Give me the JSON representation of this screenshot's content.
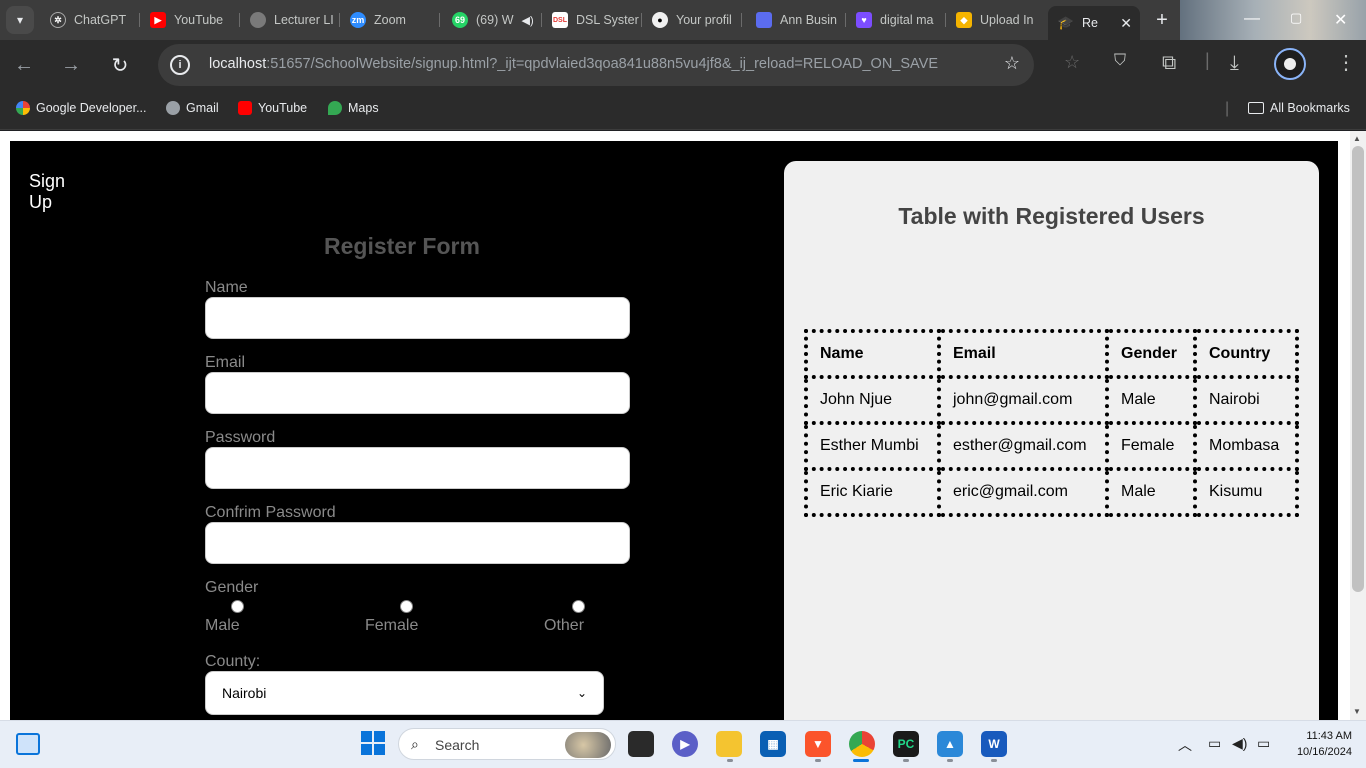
{
  "browser": {
    "tabs": [
      {
        "label": "ChatGPT",
        "icon": "chatgpt-icon",
        "color": "#ffffff"
      },
      {
        "label": "YouTube",
        "icon": "youtube-icon",
        "color": "#ff0000"
      },
      {
        "label": "Lecturer LI",
        "icon": "globe-icon",
        "color": "#7a7a7a"
      },
      {
        "label": "Zoom",
        "icon": "zoom-icon",
        "color": "#2d8cff"
      },
      {
        "label": "(69) W",
        "icon": "whatsapp-icon",
        "color": "#25d366"
      },
      {
        "label": "DSL Syster",
        "icon": "dsl-icon",
        "color": "#e53935"
      },
      {
        "label": "Your profil",
        "icon": "github-icon",
        "color": "#f0f0f0"
      },
      {
        "label": "Ann Busin",
        "icon": "app-icon",
        "color": "#5b6cf0"
      },
      {
        "label": "digital ma",
        "icon": "heart-icon",
        "color": "#7c4dff"
      },
      {
        "label": "Upload In",
        "icon": "upload-icon",
        "color": "#f5b400"
      },
      {
        "label": "Re",
        "icon": "graduation-cap-icon",
        "color": "#e8eaed"
      }
    ],
    "new_tab": "+",
    "url_host": "localhost",
    "url_rest": ":51657/SchoolWebsite/signup.html?_ijt=qpdvlaied3qoa841u88n5vu4jf8&_ij_reload=RELOAD_ON_SAVE",
    "bookmarks": [
      {
        "label": "Google Developer...",
        "color": "#4285f4"
      },
      {
        "label": "Gmail",
        "color": "#9aa0a6"
      },
      {
        "label": "YouTube",
        "color": "#ff0000"
      },
      {
        "label": "Maps",
        "color": "#34a853"
      }
    ],
    "all_bookmarks": "All Bookmarks"
  },
  "page": {
    "logo": "Sign Up",
    "form_title": "Register Form",
    "fields": {
      "name_label": "Name",
      "email_label": "Email",
      "password_label": "Password",
      "confirm_label": "Confrim Password",
      "gender_label": "Gender",
      "county_label": "County:"
    },
    "gender_options": [
      "Male",
      "Female",
      "Other"
    ],
    "county_selected": "Nairobi",
    "table_title": "Table with Registered Users",
    "table": {
      "headers": [
        "Name",
        "Email",
        "Gender",
        "Country"
      ],
      "rows": [
        [
          "John Njue",
          "john@gmail.com",
          "Male",
          "Nairobi"
        ],
        [
          "Esther Mumbi",
          "esther@gmail.com",
          "Female",
          "Mombasa"
        ],
        [
          "Eric Kiarie",
          "eric@gmail.com",
          "Male",
          "Kisumu"
        ]
      ]
    }
  },
  "taskbar": {
    "search_placeholder": "Search",
    "time": "11:43 AM",
    "date": "10/16/2024"
  }
}
